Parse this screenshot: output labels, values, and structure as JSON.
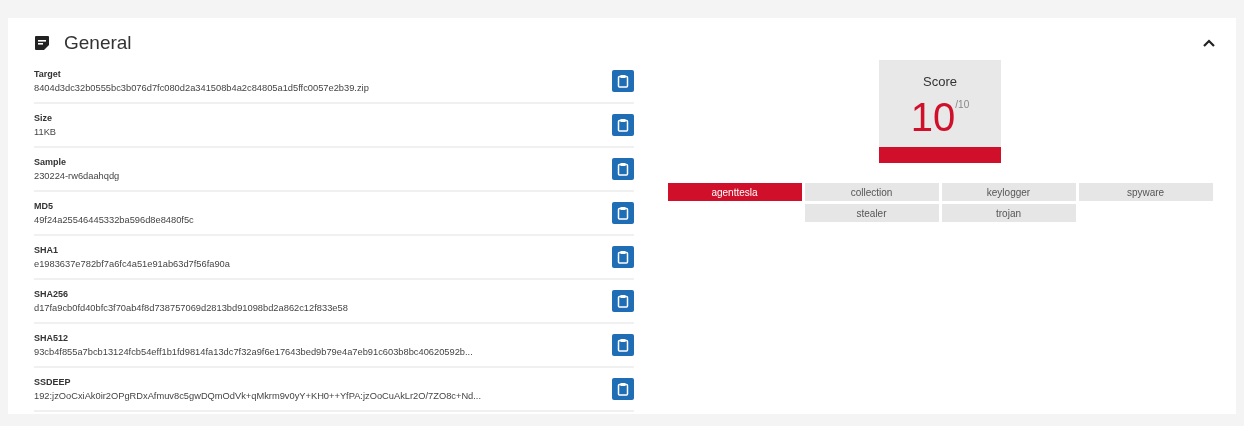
{
  "section": {
    "title": "General",
    "expanded": true
  },
  "fields": [
    {
      "label": "Target",
      "value": "8404d3dc32b0555bc3b076d7fc080d2a341508b4a2c84805a1d5ffc0057e2b39.zip"
    },
    {
      "label": "Size",
      "value": "11KB"
    },
    {
      "label": "Sample",
      "value": "230224-rw6daahqdg"
    },
    {
      "label": "MD5",
      "value": "49f24a25546445332ba596d8e8480f5c"
    },
    {
      "label": "SHA1",
      "value": "e1983637e782bf7a6fc4a51e91ab63d7f56fa90a"
    },
    {
      "label": "SHA256",
      "value": "d17fa9cb0fd40bfc3f70ab4f8d738757069d2813bd91098bd2a862c12f833e58"
    },
    {
      "label": "SHA512",
      "value": "93cb4f855a7bcb13124fcb54eff1b1fd9814fa13dc7f32a9f6e17643bed9b79e4a7eb91c603b8bc40620592b..."
    },
    {
      "label": "SSDEEP",
      "value": "192:jzOoCxiAk0ir2OPgRDxAfmuv8c5gwDQmOdVk+qMkrm9v0yY+KH0++YfPA:jzOoCuAkLr2O/7ZO8c+Nd..."
    }
  ],
  "score": {
    "label": "Score",
    "value": "10",
    "max": "/10"
  },
  "tags": [
    {
      "label": "agenttesla",
      "color": "#d0102a"
    },
    {
      "label": "collection",
      "color": "#e6e6e6"
    },
    {
      "label": "keylogger",
      "color": "#e6e6e6"
    },
    {
      "label": "spyware",
      "color": "#e6e6e6"
    },
    {
      "label": "stealer",
      "color": "#e6e6e6"
    },
    {
      "label": "trojan",
      "color": "#e6e6e6"
    }
  ]
}
